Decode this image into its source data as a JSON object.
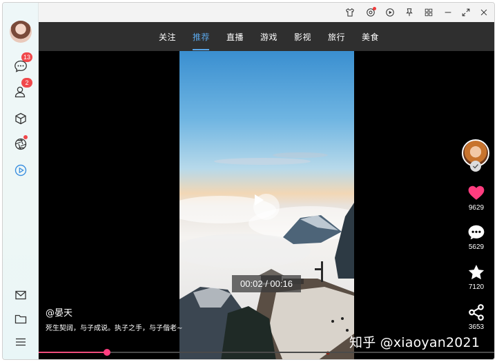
{
  "nav": {
    "tabs": [
      {
        "label": "关注",
        "active": false
      },
      {
        "label": "推荐",
        "active": true
      },
      {
        "label": "直播",
        "active": false
      },
      {
        "label": "游戏",
        "active": false
      },
      {
        "label": "影视",
        "active": false
      },
      {
        "label": "旅行",
        "active": false
      },
      {
        "label": "美食",
        "active": false
      }
    ],
    "accent_color": "#5aa6e8"
  },
  "sidebar": {
    "items": [
      {
        "icon": "chat-icon",
        "badge": "13"
      },
      {
        "icon": "contacts-icon",
        "badge": "2"
      },
      {
        "icon": "cube-icon",
        "badge": ""
      },
      {
        "icon": "aperture-icon",
        "badge_dot": true
      },
      {
        "icon": "play-circle-icon",
        "active": true
      }
    ],
    "bottom": [
      {
        "icon": "mail-icon"
      },
      {
        "icon": "folder-icon"
      },
      {
        "icon": "menu-icon"
      }
    ]
  },
  "titlebar": {
    "icons": [
      "shirt-icon",
      "aperture-icon",
      "play-circle-icon",
      "pin-icon",
      "grid-icon",
      "minimize-icon",
      "expand-icon",
      "close-icon"
    ]
  },
  "video": {
    "time": "00:02 / 00:16",
    "progress": 0.15
  },
  "actions": {
    "likes": "9629",
    "comments": "5629",
    "favorites": "7120",
    "shares": "3653",
    "like_color": "#ff3d7f"
  },
  "post": {
    "user": "@晏天",
    "caption": "死生契阔，与子成说。执子之手，与子偕老~"
  },
  "watermark": "知乎 @xiaoyan2021"
}
